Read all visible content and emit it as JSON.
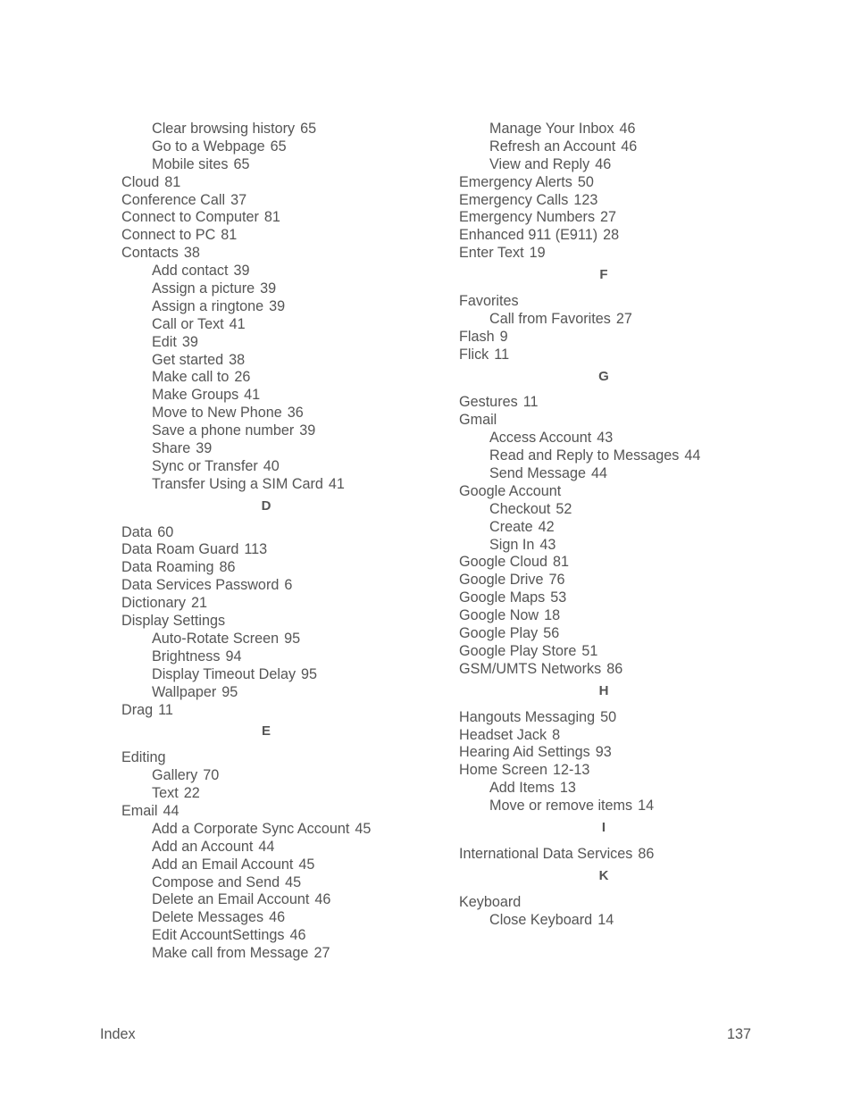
{
  "columns": [
    {
      "items": [
        {
          "type": "sub",
          "text": "Clear browsing history",
          "page": "65"
        },
        {
          "type": "sub",
          "text": "Go to a Webpage",
          "page": "65"
        },
        {
          "type": "sub",
          "text": "Mobile sites",
          "page": "65"
        },
        {
          "type": "main",
          "text": "Cloud",
          "page": "81"
        },
        {
          "type": "main",
          "text": "Conference Call",
          "page": "37"
        },
        {
          "type": "main",
          "text": "Connect to Computer",
          "page": "81"
        },
        {
          "type": "main",
          "text": "Connect to PC",
          "page": "81"
        },
        {
          "type": "main",
          "text": "Contacts",
          "page": "38"
        },
        {
          "type": "sub",
          "text": "Add contact",
          "page": "39"
        },
        {
          "type": "sub",
          "text": "Assign a picture",
          "page": "39"
        },
        {
          "type": "sub",
          "text": "Assign a ringtone",
          "page": "39"
        },
        {
          "type": "sub",
          "text": "Call or Text",
          "page": "41"
        },
        {
          "type": "sub",
          "text": "Edit",
          "page": "39"
        },
        {
          "type": "sub",
          "text": "Get started",
          "page": "38"
        },
        {
          "type": "sub",
          "text": "Make call to",
          "page": "26"
        },
        {
          "type": "sub",
          "text": "Make Groups",
          "page": "41"
        },
        {
          "type": "sub",
          "text": "Move to New Phone",
          "page": "36"
        },
        {
          "type": "sub",
          "text": "Save a phone number",
          "page": "39"
        },
        {
          "type": "sub",
          "text": "Share",
          "page": "39"
        },
        {
          "type": "sub",
          "text": "Sync or Transfer",
          "page": "40"
        },
        {
          "type": "sub",
          "text": "Transfer Using a SIM Card",
          "page": "41"
        },
        {
          "type": "letter",
          "text": "D"
        },
        {
          "type": "main",
          "text": "Data",
          "page": "60"
        },
        {
          "type": "main",
          "text": "Data Roam Guard",
          "page": "113"
        },
        {
          "type": "main",
          "text": "Data Roaming",
          "page": "86"
        },
        {
          "type": "main",
          "text": "Data Services Password",
          "page": "6"
        },
        {
          "type": "main",
          "text": "Dictionary",
          "page": "21"
        },
        {
          "type": "main",
          "text": "Display Settings",
          "page": ""
        },
        {
          "type": "sub",
          "text": "Auto-Rotate Screen",
          "page": "95"
        },
        {
          "type": "sub",
          "text": "Brightness",
          "page": "94"
        },
        {
          "type": "sub",
          "text": "Display Timeout Delay",
          "page": "95"
        },
        {
          "type": "sub",
          "text": "Wallpaper",
          "page": "95"
        },
        {
          "type": "main",
          "text": "Drag",
          "page": "11"
        },
        {
          "type": "letter",
          "text": "E"
        },
        {
          "type": "main",
          "text": "Editing",
          "page": ""
        },
        {
          "type": "sub",
          "text": "Gallery",
          "page": "70"
        },
        {
          "type": "sub",
          "text": "Text",
          "page": "22"
        },
        {
          "type": "main",
          "text": "Email",
          "page": "44"
        },
        {
          "type": "sub",
          "text": "Add a Corporate Sync Account",
          "page": "45"
        },
        {
          "type": "sub",
          "text": "Add an Account",
          "page": "44"
        },
        {
          "type": "sub",
          "text": "Add an Email Account",
          "page": "45"
        },
        {
          "type": "sub",
          "text": "Compose and Send",
          "page": "45"
        },
        {
          "type": "sub",
          "text": "Delete an Email Account",
          "page": "46"
        },
        {
          "type": "sub",
          "text": "Delete Messages",
          "page": "46"
        },
        {
          "type": "sub",
          "text": "Edit AccountSettings",
          "page": "46"
        },
        {
          "type": "sub",
          "text": "Make call from Message",
          "page": "27"
        }
      ]
    },
    {
      "items": [
        {
          "type": "sub",
          "text": "Manage Your Inbox",
          "page": "46"
        },
        {
          "type": "sub",
          "text": "Refresh an Account",
          "page": "46"
        },
        {
          "type": "sub",
          "text": "View and Reply",
          "page": "46"
        },
        {
          "type": "main",
          "text": "Emergency Alerts",
          "page": "50"
        },
        {
          "type": "main",
          "text": "Emergency Calls",
          "page": "123"
        },
        {
          "type": "main",
          "text": "Emergency Numbers",
          "page": "27"
        },
        {
          "type": "main",
          "text": "Enhanced 911 (E911)",
          "page": "28"
        },
        {
          "type": "main",
          "text": "Enter Text",
          "page": "19"
        },
        {
          "type": "letter",
          "text": "F"
        },
        {
          "type": "main",
          "text": "Favorites",
          "page": ""
        },
        {
          "type": "sub",
          "text": "Call from Favorites",
          "page": "27"
        },
        {
          "type": "main",
          "text": "Flash",
          "page": "9"
        },
        {
          "type": "main",
          "text": "Flick",
          "page": "11"
        },
        {
          "type": "letter",
          "text": "G"
        },
        {
          "type": "main",
          "text": "Gestures",
          "page": "11"
        },
        {
          "type": "main",
          "text": "Gmail",
          "page": ""
        },
        {
          "type": "sub",
          "text": "Access Account",
          "page": "43"
        },
        {
          "type": "sub",
          "text": "Read and Reply to Messages",
          "page": "44"
        },
        {
          "type": "sub",
          "text": "Send Message",
          "page": "44"
        },
        {
          "type": "main",
          "text": "Google Account",
          "page": ""
        },
        {
          "type": "sub",
          "text": "Checkout",
          "page": "52"
        },
        {
          "type": "sub",
          "text": "Create",
          "page": "42"
        },
        {
          "type": "sub",
          "text": "Sign In",
          "page": "43"
        },
        {
          "type": "main",
          "text": "Google Cloud",
          "page": "81"
        },
        {
          "type": "main",
          "text": "Google Drive",
          "page": "76"
        },
        {
          "type": "main",
          "text": "Google Maps",
          "page": "53"
        },
        {
          "type": "main",
          "text": "Google Now",
          "page": "18"
        },
        {
          "type": "main",
          "text": "Google Play",
          "page": "56"
        },
        {
          "type": "main",
          "text": "Google Play Store",
          "page": "51"
        },
        {
          "type": "main",
          "text": "GSM/UMTS Networks",
          "page": "86"
        },
        {
          "type": "letter",
          "text": "H"
        },
        {
          "type": "main",
          "text": "Hangouts Messaging",
          "page": "50"
        },
        {
          "type": "main",
          "text": "Headset Jack",
          "page": "8"
        },
        {
          "type": "main",
          "text": "Hearing Aid Settings",
          "page": "93"
        },
        {
          "type": "main",
          "text": "Home Screen",
          "page": "12-13"
        },
        {
          "type": "sub",
          "text": "Add Items",
          "page": "13"
        },
        {
          "type": "sub",
          "text": "Move or remove items",
          "page": "14"
        },
        {
          "type": "letter",
          "text": "I"
        },
        {
          "type": "main",
          "text": "International Data Services",
          "page": "86"
        },
        {
          "type": "letter",
          "text": "K"
        },
        {
          "type": "main",
          "text": "Keyboard",
          "page": ""
        },
        {
          "type": "sub",
          "text": "Close Keyboard",
          "page": "14"
        }
      ]
    }
  ],
  "footer": {
    "section": "Index",
    "page_number": "137"
  }
}
